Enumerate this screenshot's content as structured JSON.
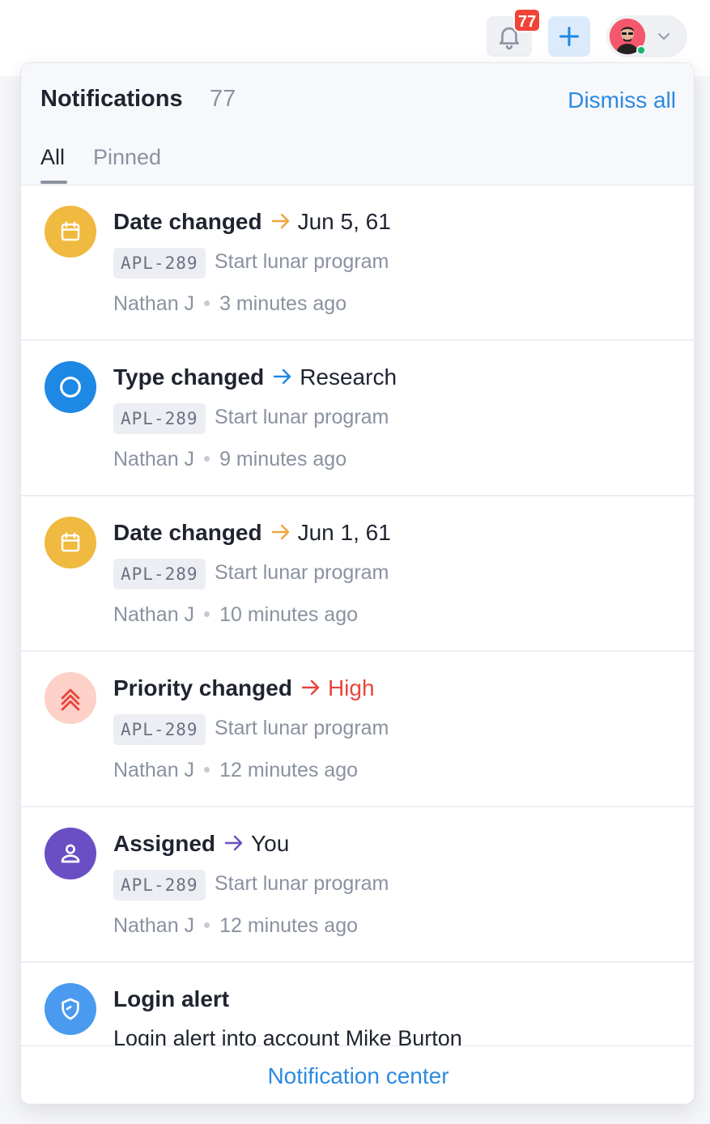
{
  "topbar": {
    "notification_badge": "77",
    "icons": {
      "bell": "bell-icon",
      "plus": "plus-icon",
      "chevron": "chevron-down-icon"
    }
  },
  "panel": {
    "title": "Notifications",
    "count": "77",
    "dismiss_label": "Dismiss all",
    "tabs": [
      {
        "label": "All",
        "active": true
      },
      {
        "label": "Pinned",
        "active": false
      }
    ],
    "footer_link": "Notification center"
  },
  "notifications": [
    {
      "title": "Date changed",
      "value": "Jun 5, 61",
      "issue_key": "APL-289",
      "issue_title": "Start lunar program",
      "author": "Nathan J",
      "time": "3 minutes ago",
      "icon": "calendar-icon",
      "icon_color": "#f0b93f",
      "arrow_color": "#f0a53f"
    },
    {
      "title": "Type changed",
      "value": "Research",
      "issue_key": "APL-289",
      "issue_title": "Start lunar program",
      "author": "Nathan J",
      "time": "9 minutes ago",
      "icon": "circle-icon",
      "icon_color": "#1e88e5",
      "arrow_color": "#1e88e5"
    },
    {
      "title": "Date changed",
      "value": "Jun 1, 61",
      "issue_key": "APL-289",
      "issue_title": "Start lunar program",
      "author": "Nathan J",
      "time": "10 minutes ago",
      "icon": "calendar-icon",
      "icon_color": "#f0b93f",
      "arrow_color": "#f0a53f"
    },
    {
      "title": "Priority changed",
      "value": "High",
      "issue_key": "APL-289",
      "issue_title": "Start lunar program",
      "author": "Nathan J",
      "time": "12 minutes ago",
      "icon": "priority-high-icon",
      "icon_color": "#fdd0c8",
      "arrow_color": "#e8453c"
    },
    {
      "title": "Assigned",
      "value": "You",
      "issue_key": "APL-289",
      "issue_title": "Start lunar program",
      "author": "Nathan J",
      "time": "12 minutes ago",
      "icon": "user-icon",
      "icon_color": "#6a4fc4",
      "arrow_color": "#6a4fc4"
    },
    {
      "title": "Login alert",
      "body": "Login alert into account Mike Burton",
      "icon": "shield-icon",
      "icon_color": "#4a9af0"
    }
  ]
}
